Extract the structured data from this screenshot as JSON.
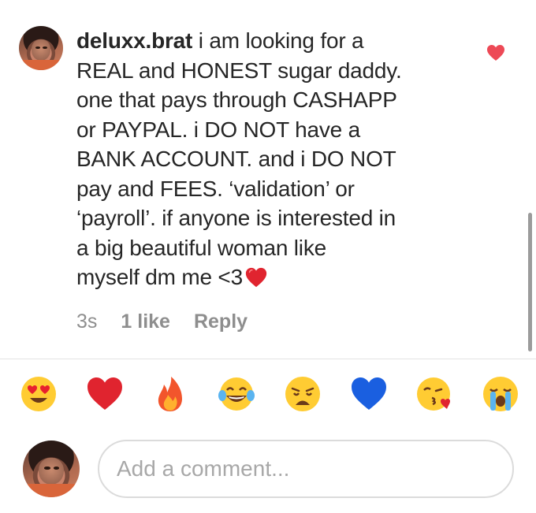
{
  "comment": {
    "username": "deluxx.brat",
    "text_lines": [
      "i am looking for a",
      "REAL and HONEST sugar daddy.",
      "one that pays through CASHAPP",
      "or PAYPAL. i DO NOT have a",
      "BANK ACCOUNT. and i DO NOT",
      "pay and FEES. ‘validation’ or",
      "‘payroll’. if anyone is interested in",
      "a big beautiful woman like",
      "myself dm me <3"
    ],
    "trailing_emoji": "red-heart-icon",
    "time": "3s",
    "likes": "1 like",
    "reply_label": "Reply"
  },
  "like_state": "liked",
  "emoji_bar": [
    "heart-eyes-emoji",
    "red-heart-emoji",
    "fire-emoji",
    "tears-of-joy-emoji",
    "weary-face-emoji",
    "blue-heart-emoji",
    "kissing-heart-emoji",
    "loudly-crying-emoji"
  ],
  "composer": {
    "placeholder": "Add a comment..."
  },
  "colors": {
    "like_heart": "#ed4956",
    "meta_text": "#8e8e8e",
    "text": "#262626"
  }
}
